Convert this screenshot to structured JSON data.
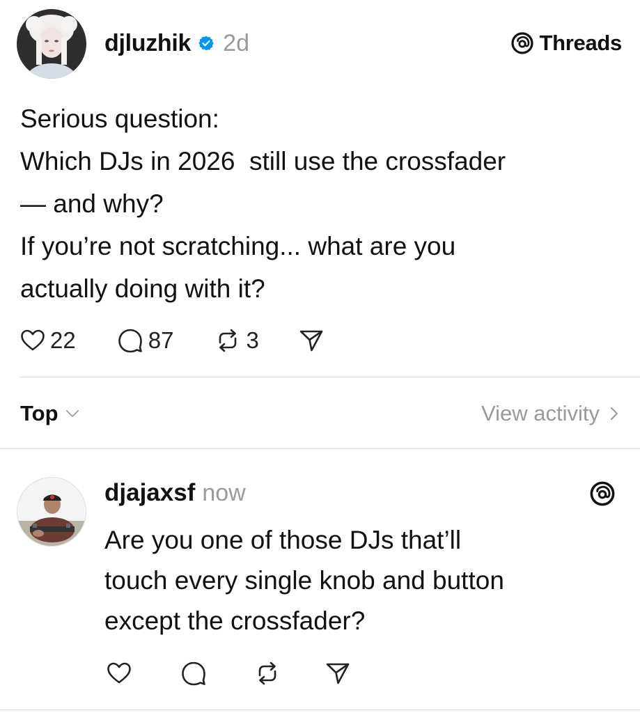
{
  "post": {
    "username": "djluzhik",
    "verified": true,
    "time": "2d",
    "threads_label": "Threads",
    "text_lines": [
      "Serious question:",
      "Which DJs in 2026  still use the crossfader",
      "— and why?",
      "If you’re not scratching... what are you",
      "actually doing with it?"
    ],
    "likes": "22",
    "replies": "87",
    "reposts": "3"
  },
  "sort": {
    "label": "Top",
    "view_activity": "View activity"
  },
  "reply": {
    "username": "djajaxsf",
    "time": "now",
    "text_lines": [
      "Are you one of those DJs that’ll",
      "touch every single knob and button",
      "except the crossfader?"
    ]
  },
  "colors": {
    "verified_blue": "#0095f6",
    "muted_text": "#9a9a9a",
    "divider": "#dedede"
  }
}
